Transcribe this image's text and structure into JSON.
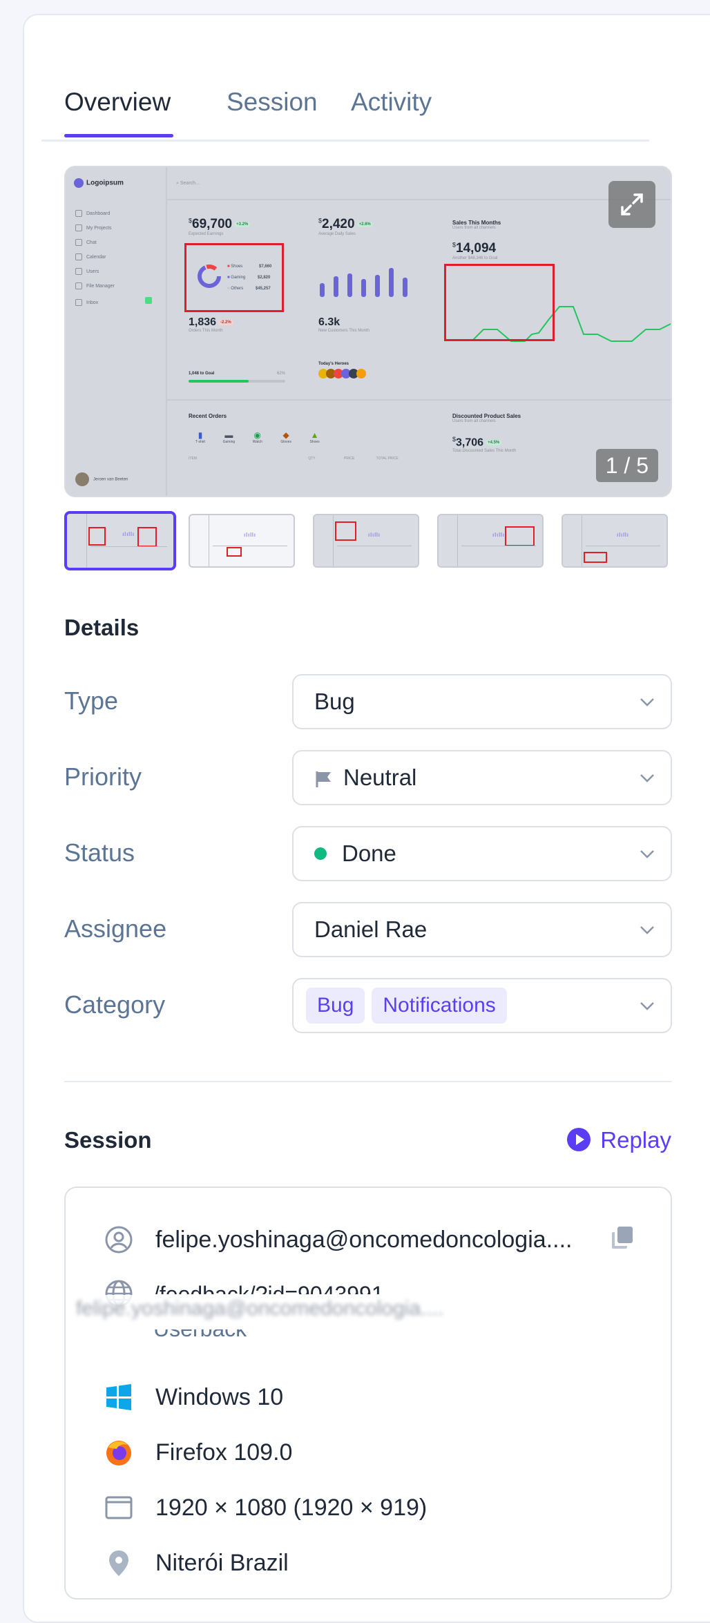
{
  "tabs": [
    {
      "label": "Overview",
      "active": true
    },
    {
      "label": "Session",
      "active": false
    },
    {
      "label": "Activity",
      "active": false
    }
  ],
  "preview": {
    "counter": "1 / 5",
    "screenshot": {
      "logo": "Logoipsum",
      "search": "Search...",
      "nav": [
        "Dashboard",
        "My Projects",
        "Chat",
        "Calendar",
        "Users",
        "File Manager",
        "Inbox"
      ],
      "stat1": {
        "value": "69,700",
        "pill": "+3.2%",
        "label": "Expected Earnings"
      },
      "stat2": {
        "value": "2,420",
        "pill": "+2.6%",
        "label": "Average Daily Sales"
      },
      "sales_title": "Sales This Months",
      "sales_sub": "Users from all channels",
      "sales_value": "14,094",
      "sales_note": "Another $48,346 to Goal",
      "legend": [
        {
          "name": "Shoes",
          "value": "$7,660"
        },
        {
          "name": "Gaming",
          "value": "$2,820"
        },
        {
          "name": "Others",
          "value": "$45,257"
        }
      ],
      "orders": {
        "value": "1,836",
        "pill": "-2.2%",
        "label": "Orders This Month"
      },
      "customers": {
        "value": "6.3k",
        "label": "New Customers This Month"
      },
      "goal": {
        "label": "1,048 to Goal",
        "pct": "62%"
      },
      "heroes": "Today's Heroes",
      "recent_orders": "Recent Orders",
      "categories": [
        "T-shirt",
        "Gaming",
        "Watch",
        "Gloves",
        "Shoes"
      ],
      "discount_title": "Discounted Product Sales",
      "discount_sub": "Users from all channels",
      "discount_value": "3,706",
      "discount_pill": "+4.5%",
      "discount_label": "Total Discounted Sales This Month",
      "table_headers": [
        "ITEM",
        "QTY",
        "PRICE",
        "TOTAL PRICE"
      ],
      "user": "Jeroen van Beeten"
    }
  },
  "details": {
    "title": "Details",
    "fields": [
      {
        "label": "Type",
        "value": "Bug"
      },
      {
        "label": "Priority",
        "value": "Neutral",
        "icon": "flag-icon"
      },
      {
        "label": "Status",
        "value": "Done",
        "status_color": "#10b981"
      },
      {
        "label": "Assignee",
        "value": "Daniel Rae"
      },
      {
        "label": "Category",
        "tags": [
          "Bug",
          "Notifications"
        ]
      }
    ]
  },
  "session": {
    "title": "Session",
    "replay_label": "Replay",
    "email": "felipe.yoshinaga@oncomedoncologia....",
    "email_tooltip": "felipe.yoshinaga@oncomedoncologia....",
    "url": "/feedback/?id=9043991",
    "url_sub": "Userback",
    "os": "Windows 10",
    "browser": "Firefox 109.0",
    "resolution": "1920 × 1080 (1920 × 919)",
    "location": "Niterói Brazil"
  },
  "colors": {
    "accent": "#5b3df5",
    "label": "#5c7594",
    "done": "#10b981",
    "windows": "#0ea5e9",
    "firefox": "#f97316"
  }
}
